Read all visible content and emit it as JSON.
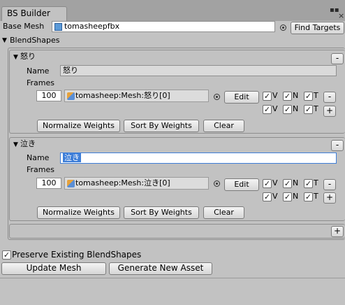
{
  "window": {
    "tab_title": "BS Builder",
    "menu_icon": "tab-menu-icon",
    "close_icon": "close-icon"
  },
  "base_mesh": {
    "label": "Base Mesh",
    "value": "tomasheepfbx",
    "find_targets_label": "Find Targets"
  },
  "blendshapes": {
    "header": "BlendShapes",
    "items": [
      {
        "title": "怒り",
        "name_label": "Name",
        "name_value": "怒り",
        "frames_label": "Frames",
        "frame": {
          "weight": "100",
          "mesh": "tomasheep:Mesh:怒り[0]",
          "edit_label": "Edit",
          "v": "V",
          "n": "N",
          "t": "T",
          "v_checked": true,
          "n_checked": true,
          "t_checked": true,
          "v2_checked": true,
          "n2_checked": true,
          "t2_checked": true
        },
        "normalize_label": "Normalize Weights",
        "sort_label": "Sort By Weights",
        "clear_label": "Clear"
      },
      {
        "title": "泣き",
        "name_label": "Name",
        "name_value": "泣き",
        "frames_label": "Frames",
        "frame": {
          "weight": "100",
          "mesh": "tomasheep:Mesh:泣き[0]",
          "edit_label": "Edit",
          "v": "V",
          "n": "N",
          "t": "T",
          "v_checked": true,
          "n_checked": true,
          "t_checked": true,
          "v2_checked": true,
          "n2_checked": true,
          "t2_checked": true
        },
        "normalize_label": "Normalize Weights",
        "sort_label": "Sort By Weights",
        "clear_label": "Clear"
      }
    ],
    "remove_label": "-",
    "add_label": "+"
  },
  "footer": {
    "preserve_label": "Preserve Existing BlendShapes",
    "preserve_checked": true,
    "update_mesh_label": "Update Mesh",
    "generate_asset_label": "Generate New Asset"
  },
  "glyphs": {
    "check": "✓",
    "fold_open": "▼"
  }
}
